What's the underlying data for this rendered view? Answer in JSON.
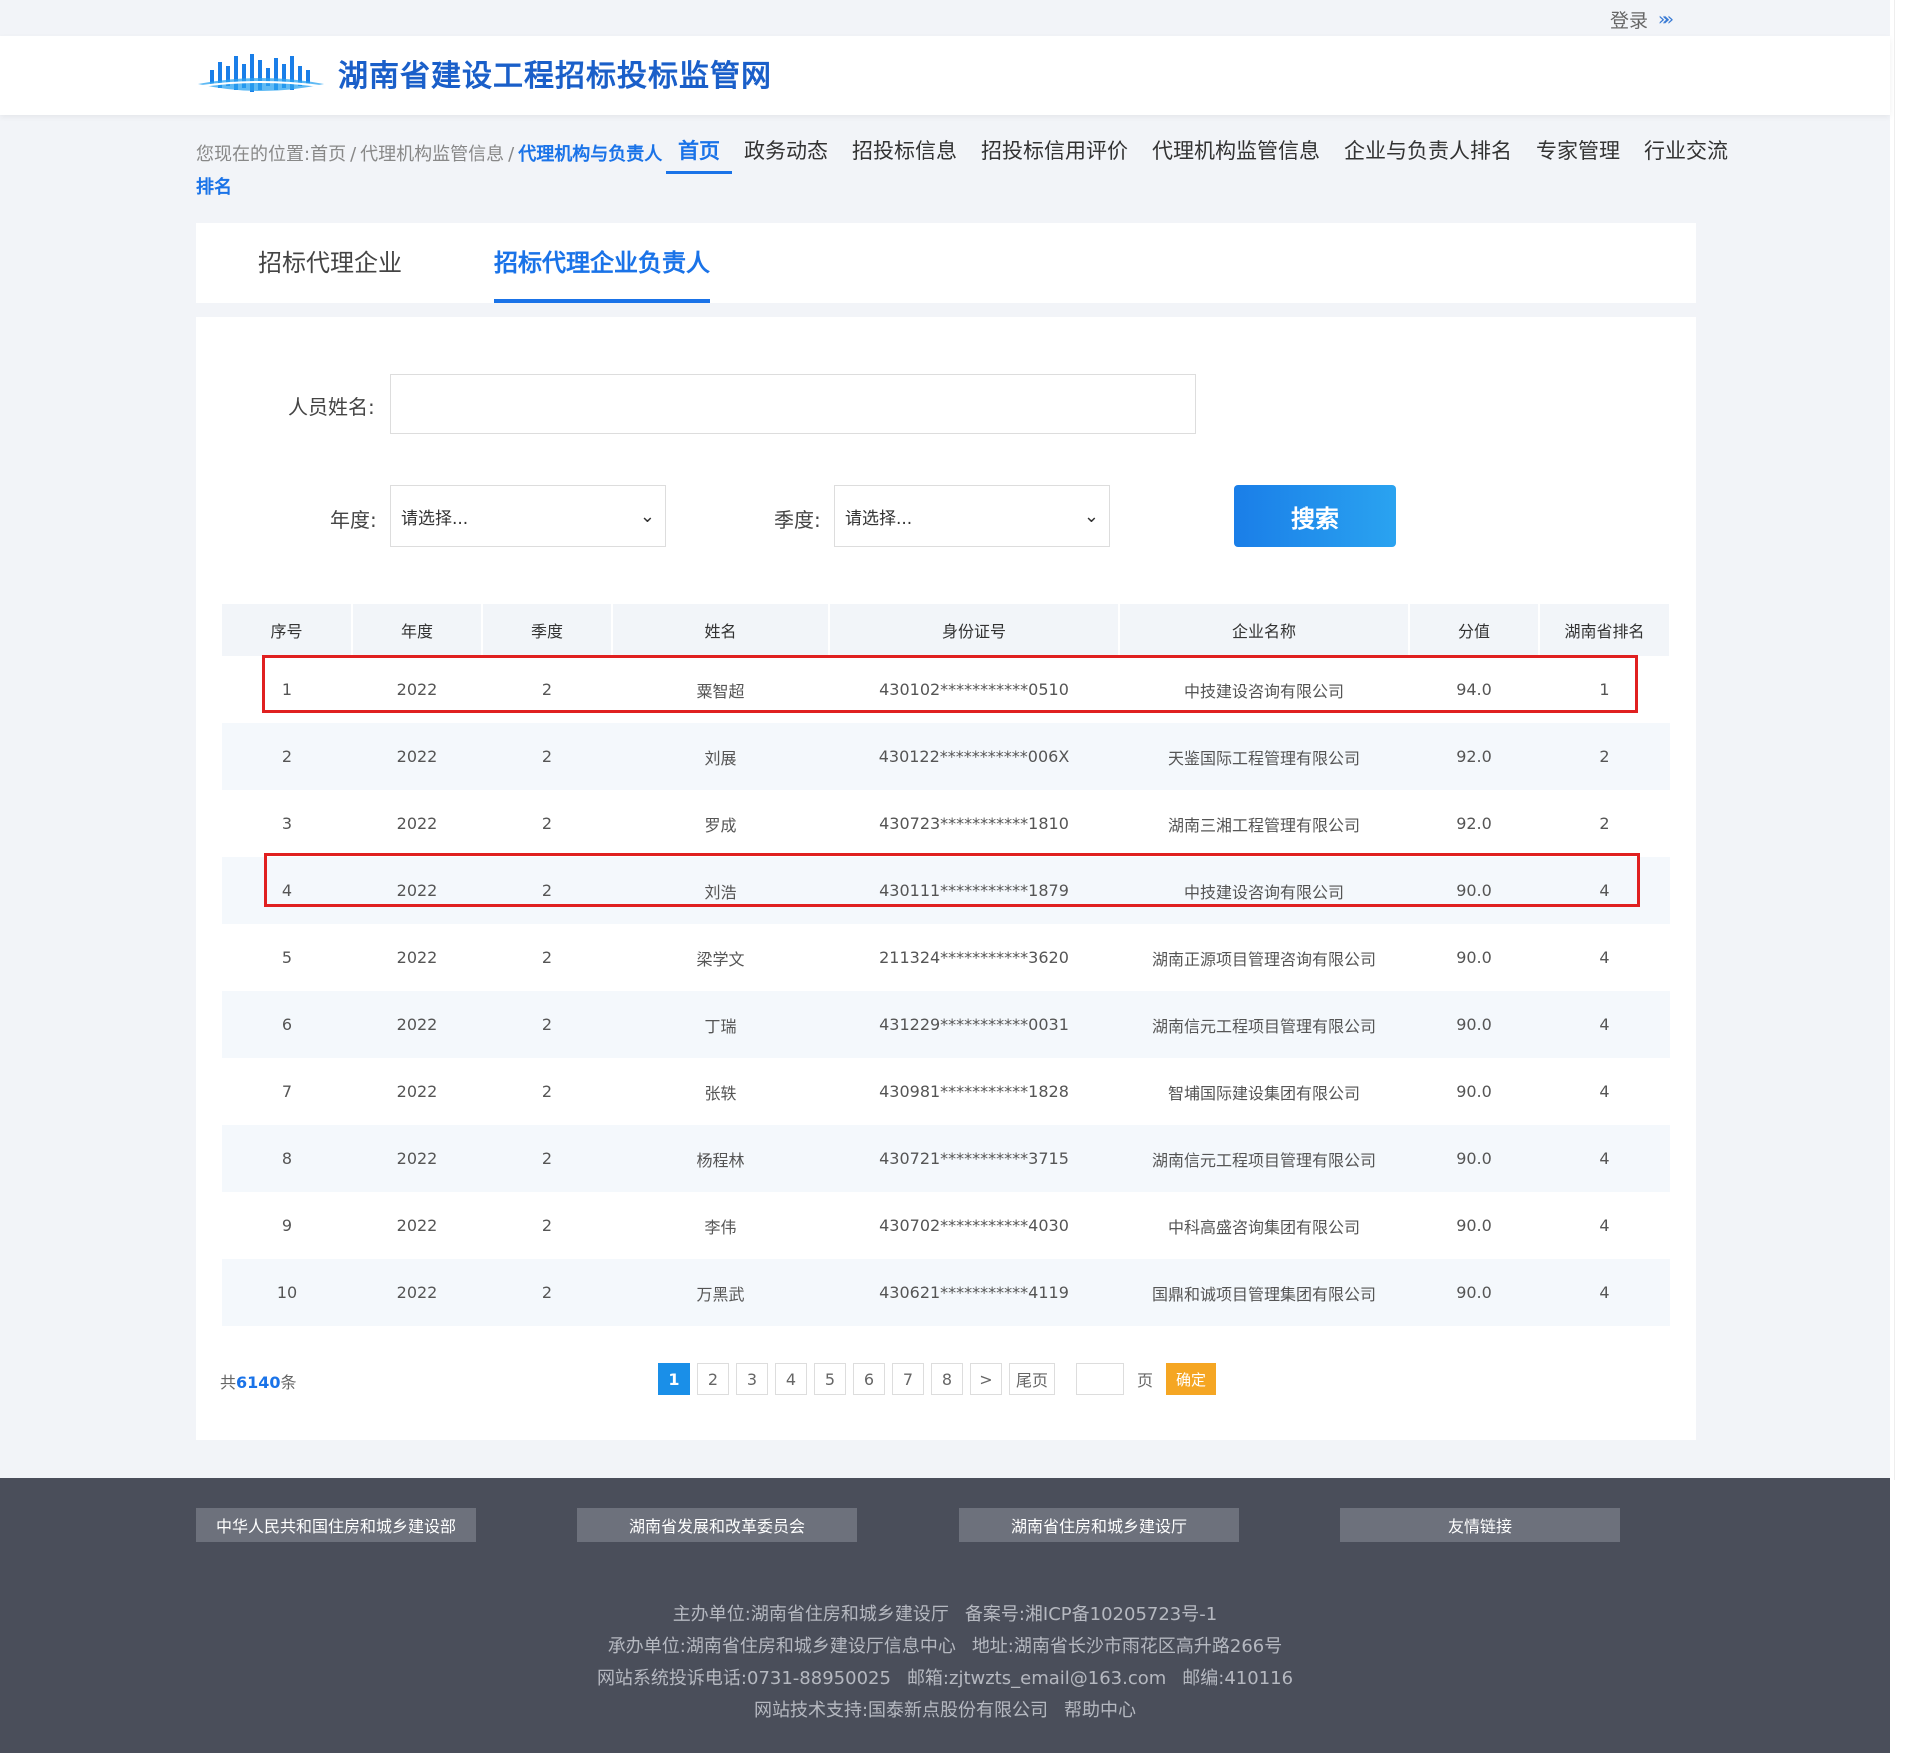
{
  "topbar": {
    "login": "登录"
  },
  "site": {
    "title": "湖南省建设工程招标投标监管网"
  },
  "breadcrumb": {
    "prefix": "您现在的位置:",
    "home": "首页",
    "section": "代理机构监管信息",
    "current": "代理机构与负责人排名"
  },
  "nav": [
    {
      "label": "首页",
      "active": true
    },
    {
      "label": "政务动态"
    },
    {
      "label": "招投标信息"
    },
    {
      "label": "招投标信用评价"
    },
    {
      "label": "代理机构监管信息"
    },
    {
      "label": "企业与负责人排名"
    },
    {
      "label": "专家管理"
    },
    {
      "label": "行业交流"
    }
  ],
  "tabs": {
    "agency": "招标代理企业",
    "leader": "招标代理企业负责人"
  },
  "filters": {
    "name_label": "人员姓名:",
    "name_value": "",
    "year_label": "年度:",
    "year_value": "请选择...",
    "quarter_label": "季度:",
    "quarter_value": "请选择...",
    "search_label": "搜索"
  },
  "table": {
    "headers": [
      "序号",
      "年度",
      "季度",
      "姓名",
      "身份证号",
      "企业名称",
      "分值",
      "湖南省排名"
    ],
    "rows": [
      [
        "1",
        "2022",
        "2",
        "粟智超",
        "430102***********0510",
        "中技建设咨询有限公司",
        "94.0",
        "1"
      ],
      [
        "2",
        "2022",
        "2",
        "刘展",
        "430122***********006X",
        "天鉴国际工程管理有限公司",
        "92.0",
        "2"
      ],
      [
        "3",
        "2022",
        "2",
        "罗成",
        "430723***********1810",
        "湖南三湘工程管理有限公司",
        "92.0",
        "2"
      ],
      [
        "4",
        "2022",
        "2",
        "刘浩",
        "430111***********1879",
        "中技建设咨询有限公司",
        "90.0",
        "4"
      ],
      [
        "5",
        "2022",
        "2",
        "梁学文",
        "211324***********3620",
        "湖南正源项目管理咨询有限公司",
        "90.0",
        "4"
      ],
      [
        "6",
        "2022",
        "2",
        "丁瑞",
        "431229***********0031",
        "湖南信元工程项目管理有限公司",
        "90.0",
        "4"
      ],
      [
        "7",
        "2022",
        "2",
        "张轶",
        "430981***********1828",
        "智埔国际建设集团有限公司",
        "90.0",
        "4"
      ],
      [
        "8",
        "2022",
        "2",
        "杨程林",
        "430721***********3715",
        "湖南信元工程项目管理有限公司",
        "90.0",
        "4"
      ],
      [
        "9",
        "2022",
        "2",
        "李伟",
        "430702***********4030",
        "中科高盛咨询集团有限公司",
        "90.0",
        "4"
      ],
      [
        "10",
        "2022",
        "2",
        "万黑武",
        "430621***********4119",
        "国鼎和诚项目管理集团有限公司",
        "90.0",
        "4"
      ]
    ]
  },
  "pager": {
    "total_prefix": "共",
    "total_count": "6140",
    "total_suffix": "条",
    "pages": [
      "1",
      "2",
      "3",
      "4",
      "5",
      "6",
      "7",
      "8"
    ],
    "next": ">",
    "last": "尾页",
    "unit": "页",
    "ok": "确定"
  },
  "footer": {
    "links": [
      "中华人民共和国住房和城乡建设部",
      "湖南省发展和改革委员会",
      "湖南省住房和城乡建设厅",
      "友情链接"
    ],
    "line1": [
      "主办单位:湖南省住房和城乡建设厅",
      "备案号:湘ICP备10205723号-1"
    ],
    "line2": [
      "承办单位:湖南省住房和城乡建设厅信息中心",
      "地址:湖南省长沙市雨花区高升路266号"
    ],
    "line3": [
      "网站系统投诉电话:0731-88950025",
      "邮箱:zjtwzts_email@163.com",
      "邮编:410116"
    ],
    "line4": [
      "网站技术支持:国泰新点股份有限公司",
      "帮助中心"
    ]
  },
  "colors": {
    "accent": "#1a73e8",
    "highlight": "#e02020",
    "footer": "#4a4e5a",
    "ok_button": "#f5a623"
  }
}
